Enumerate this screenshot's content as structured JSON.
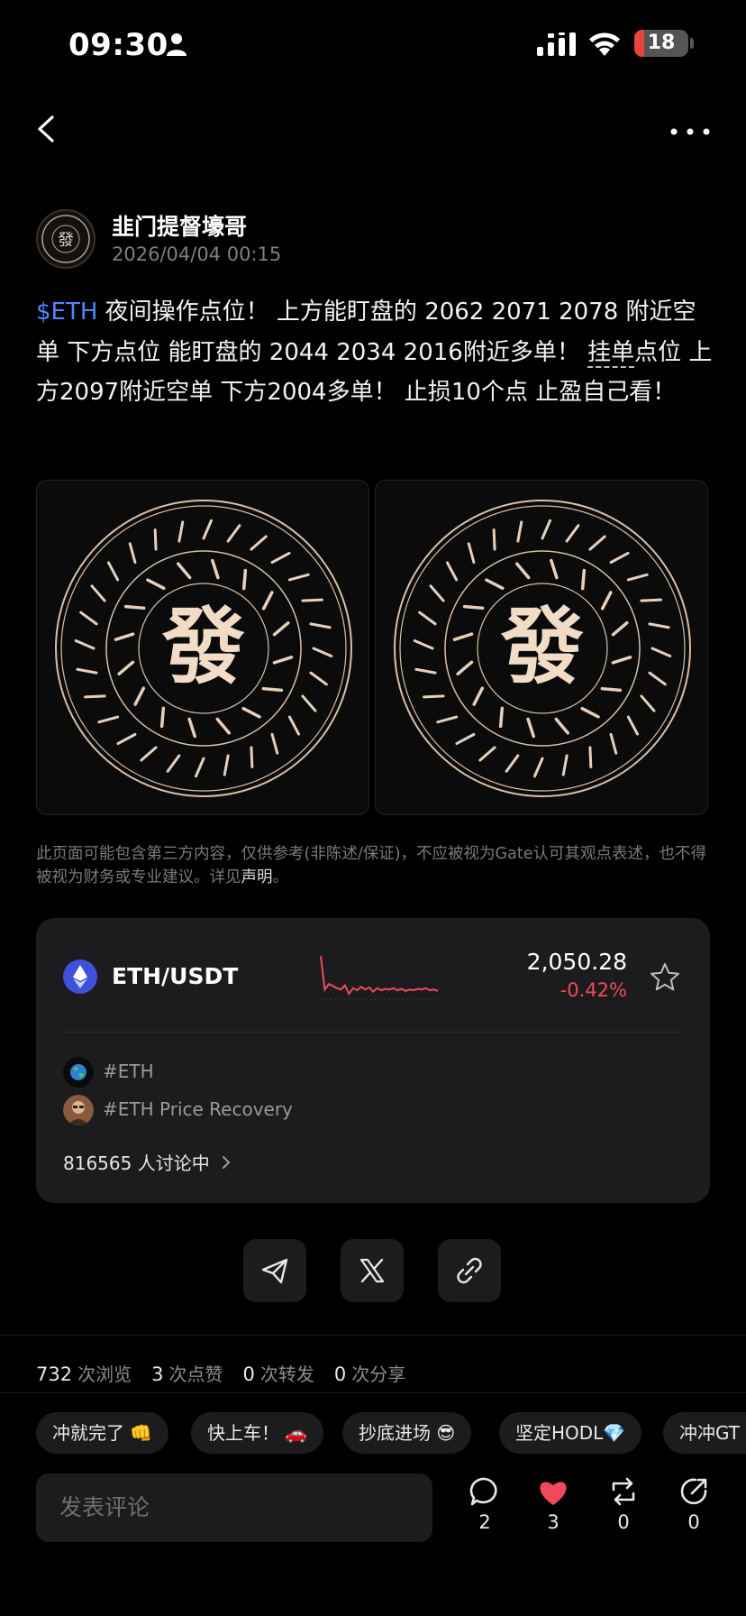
{
  "status_bar": {
    "time": "09:30",
    "battery_level": "18",
    "battery_fraction": 0.18
  },
  "author": {
    "name": "韭门提督壕哥",
    "timestamp": "2026/04/04 00:15"
  },
  "post": {
    "tag": "$ETH",
    "text_part1": " 夜间操作点位！ 上方能盯盘的 2062 2071 2078 附近空单  下方点位 能盯盘的 2044 2034 2016附近多单！ ",
    "underlined_term": "挂单",
    "text_part2": "点位 上方2097附近空单 下方2004多单！ 止损10个点 止盈自己看！",
    "image_glyph": "發",
    "image_count": 2
  },
  "disclaimer": {
    "text": "此页面可能包含第三方内容，仅供参考(非陈述/保证)，不应被视为Gate认可其观点表述，也不得被视为财务或专业建议。详见",
    "link": "声明",
    "end": "。"
  },
  "market": {
    "pair": "ETH/USDT",
    "price": "2,050.28",
    "change": "-0.42%",
    "change_color": "#ef4a5c",
    "sparkline": [
      98,
      50,
      58,
      55,
      52,
      50,
      56,
      44,
      52,
      49,
      54,
      50,
      53,
      47,
      52,
      49,
      51,
      50,
      52,
      49,
      51,
      48,
      50,
      49,
      51,
      50,
      52,
      49,
      50,
      48
    ],
    "topics": [
      {
        "label": "#ETH",
        "icon": "earth-icon"
      },
      {
        "label": "#ETH Price Recovery",
        "icon": "user-avatar"
      }
    ],
    "discussing": "816565 人讨论中"
  },
  "share": {
    "buttons": [
      "telegram-icon",
      "x-icon",
      "link-icon"
    ]
  },
  "stats": {
    "views": "732",
    "views_label": "次浏览",
    "likes": "3",
    "likes_label": "次点赞",
    "reposts": "0",
    "reposts_label": "次转发",
    "shares": "0",
    "shares_label": "次分享"
  },
  "quick_replies": [
    "冲就完了 👊",
    "快上车！ 🚗",
    "抄底进场 😎",
    "坚定HODL💎",
    "冲冲GT"
  ],
  "bottom_bar": {
    "comment_placeholder": "发表评论",
    "comment_count": "2",
    "like_count": "3",
    "repost_count": "0",
    "share_count": "0",
    "like_color": "#ef4a5c"
  }
}
